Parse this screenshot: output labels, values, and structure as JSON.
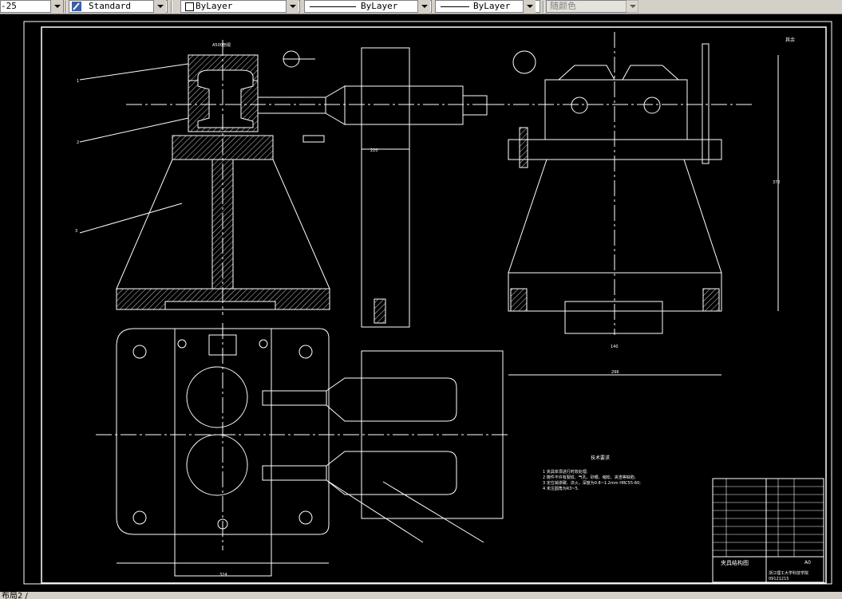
{
  "toolbar": {
    "dim_style": "-25",
    "text_style": "Standard",
    "layer": "ByLayer",
    "linetype": "ByLayer",
    "lineweight": "ByLayer",
    "color": "随颜色"
  },
  "drawing": {
    "section_label": "A500剖视",
    "tech_title": "技术要求",
    "tech_items": [
      "1 夹具体须进行时效处理;",
      "2 铸件不许有裂纹、气孔、砂眼、缩松、夹渣等缺陷;",
      "3 定位销渗碳、淬火，深度为0.8~1.2mm  HRC55-60;",
      "4 未注圆角为R3~5."
    ],
    "title_block_name": "夹具结构图",
    "title_block_sheet": "A0",
    "title_block_school": "浙江理工大学科技学院",
    "title_block_code": "09121215",
    "roughness_note": "其余",
    "label_1": "1",
    "label_2": "2",
    "label_3": "3",
    "dim_220": "220",
    "dim_140": "140",
    "dim_372": "372",
    "dim_296": "296",
    "dim_324": "324"
  },
  "status": {
    "tab": "布局2 /"
  }
}
